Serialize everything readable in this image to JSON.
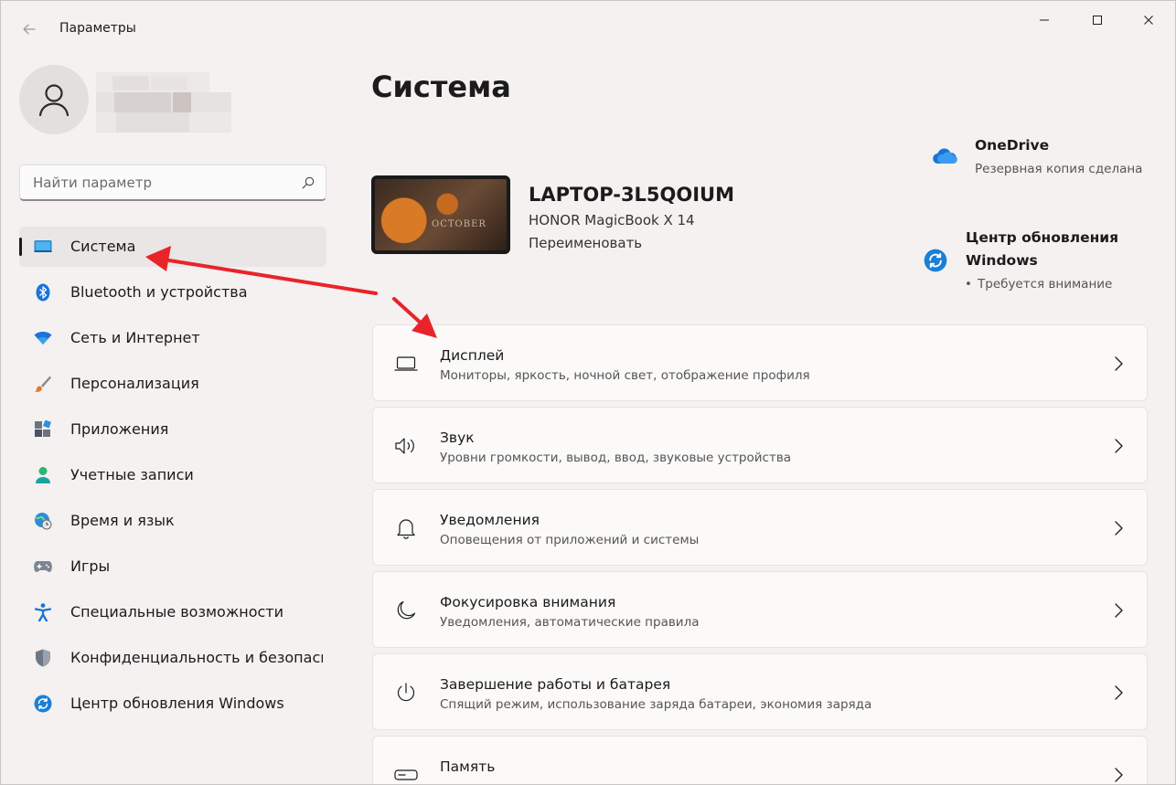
{
  "window": {
    "title": "Параметры",
    "back_icon": "back-arrow-icon",
    "minimize_icon": "minimize-icon",
    "maximize_icon": "maximize-icon",
    "close_icon": "close-icon"
  },
  "search": {
    "placeholder": "Найти параметр",
    "icon": "search-icon"
  },
  "sidebar": {
    "items": [
      {
        "label": "Система",
        "icon": "system-display-icon",
        "active": true
      },
      {
        "label": "Bluetooth и устройства",
        "icon": "bluetooth-icon"
      },
      {
        "label": "Сеть и Интернет",
        "icon": "wifi-icon"
      },
      {
        "label": "Персонализация",
        "icon": "brush-icon"
      },
      {
        "label": "Приложения",
        "icon": "apps-icon"
      },
      {
        "label": "Учетные записи",
        "icon": "accounts-icon"
      },
      {
        "label": "Время и язык",
        "icon": "globe-clock-icon"
      },
      {
        "label": "Игры",
        "icon": "gamepad-icon"
      },
      {
        "label": "Специальные возможности",
        "icon": "accessibility-icon"
      },
      {
        "label": "Конфиденциальность и безопасность",
        "icon": "shield-icon"
      },
      {
        "label": "Центр обновления Windows",
        "icon": "windows-update-icon"
      }
    ]
  },
  "main": {
    "title": "Система",
    "device": {
      "name": "LAPTOP-3L5QOIUM",
      "model": "HONOR MagicBook X 14",
      "rename_link": "Переименовать"
    },
    "status": {
      "onedrive": {
        "title": "OneDrive",
        "subtitle": "Резервная копия сделана",
        "icon": "onedrive-cloud-icon"
      },
      "update": {
        "title_line1": "Центр обновления",
        "title_line2": "Windows",
        "subtitle": "Требуется внимание",
        "bullet": "•",
        "icon": "windows-update-icon"
      }
    },
    "cards": [
      {
        "title": "Дисплей",
        "subtitle": "Мониторы, яркость, ночной свет, отображение профиля",
        "icon": "laptop-display-icon"
      },
      {
        "title": "Звук",
        "subtitle": "Уровни громкости, вывод, ввод, звуковые устройства",
        "icon": "speaker-icon"
      },
      {
        "title": "Уведомления",
        "subtitle": "Оповещения от приложений и системы",
        "icon": "bell-icon"
      },
      {
        "title": "Фокусировка внимания",
        "subtitle": "Уведомления, автоматические правила",
        "icon": "moon-icon"
      },
      {
        "title": "Завершение работы и батарея",
        "subtitle": "Спящий режим, использование заряда батареи, экономия заряда",
        "icon": "power-icon"
      },
      {
        "title": "Память",
        "subtitle": "",
        "icon": "storage-icon"
      }
    ]
  },
  "colors": {
    "annotation_arrow": "#e8242a",
    "accent": "#0067c0",
    "window_bg": "#f4f1f0",
    "card_bg": "#fbfaf9"
  }
}
